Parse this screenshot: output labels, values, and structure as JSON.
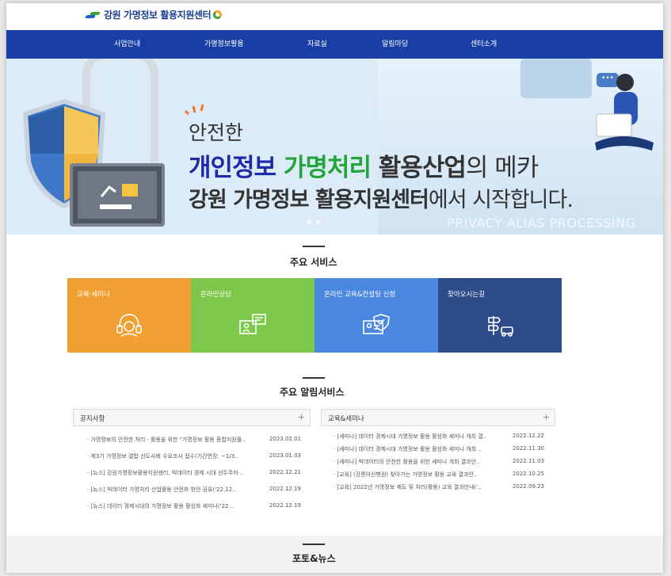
{
  "header": {
    "logo_text": "강원 가명정보 활용지원센터"
  },
  "nav": {
    "items": [
      "사업안내",
      "가명정보활용",
      "자료실",
      "알림마당",
      "센터소개"
    ]
  },
  "hero": {
    "line1": "안전한",
    "line2_part1": "개인정보",
    "line2_part2": "가명처리",
    "line2_part3": "활용산업",
    "line2_part4": "의 메카",
    "line3_part1": "강원 가명정보 활용지원센터",
    "line3_part2": "에서 시작합니다.",
    "watermark": "PRIVACY ALIAS PROCESSING",
    "bubble": "•••"
  },
  "services": {
    "title": "주요 서비스",
    "items": [
      {
        "label": "교육·세미나",
        "color": "#f0a033",
        "icon": "headset-icon"
      },
      {
        "label": "온라인상담",
        "color": "#7dc84a",
        "icon": "chat-consult-icon"
      },
      {
        "label": "온라인 교육&컨설팅 신청",
        "color": "#4a87e0",
        "icon": "shield-monitor-icon"
      },
      {
        "label": "찾아오시는길",
        "color": "#2e4c8a",
        "icon": "signpost-car-icon"
      }
    ]
  },
  "notices": {
    "title": "주요 알림서비스",
    "boards": [
      {
        "title": "공지사항",
        "more": "+",
        "rows": [
          {
            "text": "· 가명정보의 안전한 처리 · 활용을 위한 \"가명정보 활용 종합지원플..",
            "date": "2023.02.01"
          },
          {
            "text": "· 제3기 가명정보 결합 선도사례 수요조사 접수(기간연장: ~1/3..",
            "date": "2023.01.03"
          },
          {
            "text": "· [뉴스] 강원가명정보활용지원센터, 빅데이터 경제 시대 선두주자 ..",
            "date": "2022.12.21"
          },
          {
            "text": "· [뉴스] 빅데이터 가명처리 산업활용 안전화 방안 공유('22.12..",
            "date": "2022.12.19"
          },
          {
            "text": "· [뉴스] 데이터 경제시대의 가명정보 활용 활성화 세미나('22...",
            "date": "2022.12.19"
          }
        ]
      },
      {
        "title": "교육&세미나",
        "more": "+",
        "rows": [
          {
            "text": "· [세미나] 데이터 경제시대 가명정보 활용 활성화 세미나 개최 결..",
            "date": "2022.12.22"
          },
          {
            "text": "· [세미나] 데이터 경제시대 가명정보 활용 활성화 세미나 개최 ..",
            "date": "2022.11.30"
          },
          {
            "text": "· [세미나] 빅데이터의 안전한 활용을 위한 세미나 개최 결과안..",
            "date": "2022.11.03"
          },
          {
            "text": "· [교육] (강릉아산병원) 찾아가는 가명정보 활용 교육 결과안..",
            "date": "2022.10.25"
          },
          {
            "text": "· [교육] 2022년 가명정보 제도 및 처리(활용) 교육 결과안내('..",
            "date": "2022.09.23"
          }
        ]
      }
    ]
  },
  "photo_news": {
    "title": "포토&뉴스"
  }
}
